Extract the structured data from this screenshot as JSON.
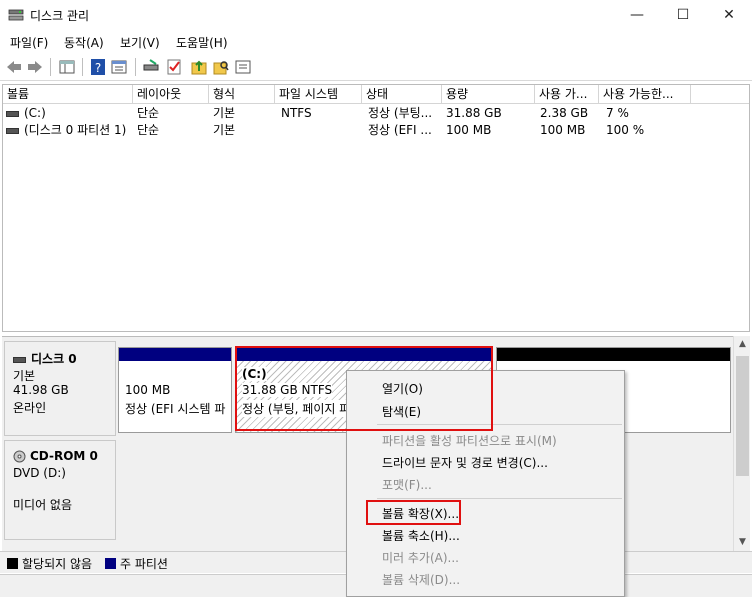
{
  "window": {
    "title": "디스크 관리",
    "min_glyph": "—",
    "max_glyph": "☐",
    "close_glyph": "✕"
  },
  "menu": [
    "파일(F)",
    "동작(A)",
    "보기(V)",
    "도움말(H)"
  ],
  "columns": [
    "볼륨",
    "레이아웃",
    "형식",
    "파일 시스템",
    "상태",
    "용량",
    "사용 가...",
    "사용 가능한..."
  ],
  "volumes": [
    {
      "volume": "(C:)",
      "layout": "단순",
      "type": "기본",
      "fs": "NTFS",
      "status": "정상 (부팅...",
      "capacity": "31.88 GB",
      "free": "2.38 GB",
      "pct": "7 %"
    },
    {
      "volume": "(디스크 0 파티션 1)",
      "layout": "단순",
      "type": "기본",
      "fs": "",
      "status": "정상 (EFI ...",
      "capacity": "100 MB",
      "free": "100 MB",
      "pct": "100 %"
    }
  ],
  "disk0": {
    "name": "디스크 0",
    "type": "기본",
    "size": "41.98 GB",
    "status": "온라인",
    "partitions": [
      {
        "line1": "100 MB",
        "line2": "정상 (EFI 시스템 파"
      },
      {
        "title": "(C:)",
        "line1": "31.88 GB NTFS",
        "line2": "정상 (부팅, 페이지 파"
      }
    ]
  },
  "cdrom": {
    "name": "CD-ROM 0",
    "type": "DVD (D:)",
    "status": "미디어 없음"
  },
  "legend": {
    "unallocated": "할당되지 않음",
    "primary": "주 파티션",
    "colors": {
      "unallocated": "#000000",
      "primary": "#000080"
    }
  },
  "context_menu": {
    "open": "열기(O)",
    "explore": "탐색(E)",
    "mark_active": "파티션을 활성 파티션으로 표시(M)",
    "change_letter": "드라이브 문자 및 경로 변경(C)...",
    "format": "포맷(F)...",
    "extend": "볼륨 확장(X)...",
    "shrink": "볼륨 축소(H)...",
    "add_mirror": "미러 추가(A)...",
    "delete": "볼륨 삭제(D)..."
  },
  "highlight_color": "#e01010"
}
